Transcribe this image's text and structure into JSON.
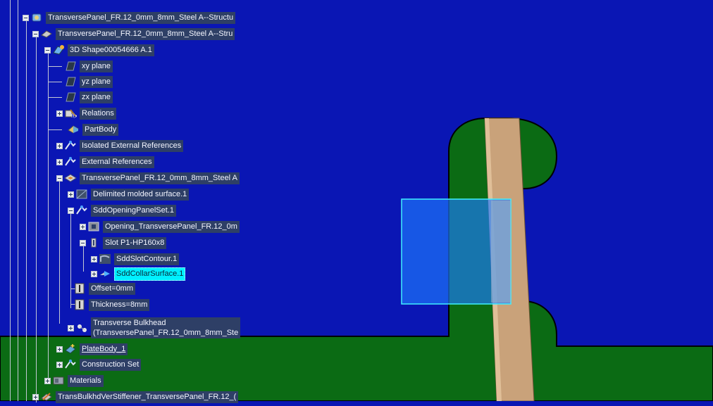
{
  "colors": {
    "background": "#0a16b4",
    "plate": "#0b6b14",
    "stiffener": "#c9a27a",
    "selection": "#00f0ff",
    "label_bg": "#2e3f66"
  },
  "tree": {
    "items": [
      {
        "label": "TransversePanel_FR.12_0mm_8mm_Steel A--Structu",
        "icon": "product-icon",
        "expander": "minus"
      },
      {
        "label": "TransversePanel_FR.12_0mm_8mm_Steel A--Stru",
        "icon": "part-icon",
        "expander": "minus"
      },
      {
        "label": "3D Shape00054666 A.1",
        "icon": "shape-icon",
        "expander": "minus"
      },
      {
        "label": "xy plane",
        "icon": "plane-icon",
        "expander": "none"
      },
      {
        "label": "yz plane",
        "icon": "plane-icon",
        "expander": "none"
      },
      {
        "label": "zx plane",
        "icon": "plane-icon",
        "expander": "none"
      },
      {
        "label": "Relations",
        "icon": "relations-icon",
        "expander": "plus"
      },
      {
        "label": "PartBody",
        "icon": "partbody-icon",
        "expander": "none"
      },
      {
        "label": "Isolated External References",
        "icon": "geometric-set-icon",
        "expander": "plus"
      },
      {
        "label": "External References",
        "icon": "geometric-set-icon",
        "expander": "plus"
      },
      {
        "label": "TransversePanel_FR.12_0mm_8mm_Steel A",
        "icon": "panel-icon",
        "expander": "minus"
      },
      {
        "label": "Delimited molded surface.1",
        "icon": "surface-icon",
        "expander": "plus"
      },
      {
        "label": "SddOpeningPanelSet.1",
        "icon": "geometric-set-icon",
        "expander": "minus"
      },
      {
        "label": "Opening_TransversePanel_FR.12_0m",
        "icon": "opening-icon",
        "expander": "plus"
      },
      {
        "label": "Slot P1-HP160x8",
        "icon": "slot-icon",
        "expander": "minus"
      },
      {
        "label": "SddSlotContour.1",
        "icon": "contour-icon",
        "expander": "plus"
      },
      {
        "label": "SddCollarSurface.1",
        "icon": "collar-surface-icon",
        "expander": "plus",
        "selected": true
      },
      {
        "label": "Offset=0mm",
        "icon": "parameter-icon",
        "expander": "none"
      },
      {
        "label": "Thickness=8mm",
        "icon": "parameter-icon",
        "expander": "none"
      },
      {
        "label": "Transverse Bulkhead",
        "label2": "(TransversePanel_FR.12_0mm_8mm_Ste",
        "icon": "bulkhead-icon",
        "expander": "plus"
      },
      {
        "label": "PlateBody_1",
        "icon": "platebody-icon",
        "expander": "plus",
        "underline": true
      },
      {
        "label": "Construction Set",
        "icon": "geometric-set-icon",
        "expander": "plus"
      },
      {
        "label": "Materials",
        "icon": "materials-icon",
        "expander": "plus"
      },
      {
        "label": "TransBulkhdVerStiffener_TransversePanel_FR.12_(",
        "icon": "stiffener-part-icon",
        "expander": "plus"
      }
    ]
  }
}
